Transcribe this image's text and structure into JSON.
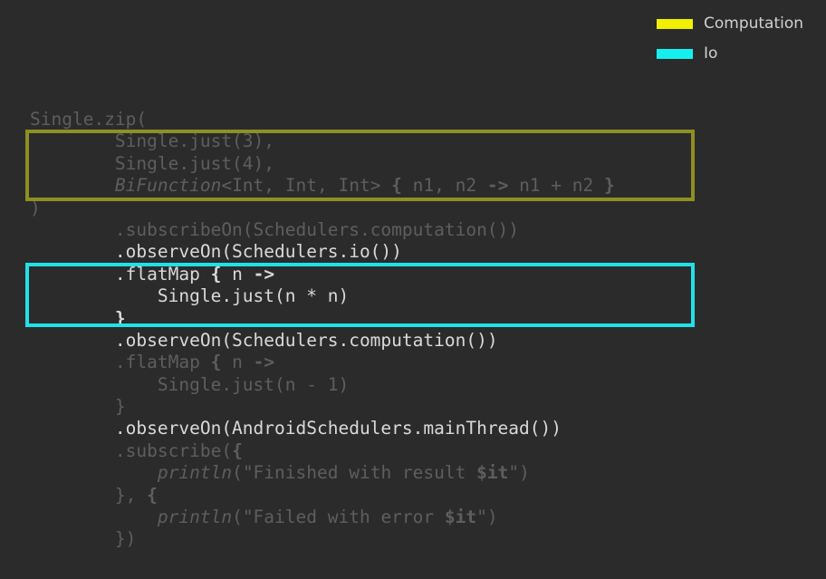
{
  "colors": {
    "background": "#2b2b2b",
    "computation": "#f0f000",
    "computation_box": "#8f8f22",
    "io": "#14f0f0",
    "io_box": "#22e0e8",
    "code_dim": "#5e5e5e",
    "code_bright": "#d9d9d9"
  },
  "legend": [
    {
      "label": "Computation",
      "color": "#f0f000"
    },
    {
      "label": "Io",
      "color": "#14f0f0"
    }
  ],
  "code": {
    "lines": [
      [
        {
          "text": "Single.zip(",
          "style": "dim"
        }
      ],
      [
        {
          "text": "        Single.just(3),",
          "style": "dim"
        }
      ],
      [
        {
          "text": "        Single.just(4),",
          "style": "dim"
        }
      ],
      [
        {
          "text": "        ",
          "style": "dim"
        },
        {
          "text": "BiFunction",
          "style": "dim italic"
        },
        {
          "text": "<Int, Int, Int> ",
          "style": "dim"
        },
        {
          "text": "{",
          "style": "dim bold"
        },
        {
          "text": " n1, n2 ",
          "style": "dim"
        },
        {
          "text": "->",
          "style": "dim bold"
        },
        {
          "text": " n1 + n2 ",
          "style": "dim"
        },
        {
          "text": "}",
          "style": "dim bold"
        }
      ],
      [
        {
          "text": ")",
          "style": "dim"
        }
      ],
      [
        {
          "text": "        .subscribeOn(Schedulers.computation())",
          "style": "dim"
        }
      ],
      [
        {
          "text": "        .observeOn(Schedulers.io())",
          "style": "bright"
        }
      ],
      [
        {
          "text": "        .flatMap ",
          "style": "bright"
        },
        {
          "text": "{",
          "style": "bright bold"
        },
        {
          "text": " n ",
          "style": "bright"
        },
        {
          "text": "->",
          "style": "bright bold"
        }
      ],
      [
        {
          "text": "            Single.just(n * n)",
          "style": "bright"
        }
      ],
      [
        {
          "text": "        ",
          "style": "bright"
        },
        {
          "text": "}",
          "style": "bright bold"
        }
      ],
      [
        {
          "text": "        .observeOn(Schedulers.computation())",
          "style": "bright"
        }
      ],
      [
        {
          "text": "        .flatMap ",
          "style": "dim"
        },
        {
          "text": "{",
          "style": "dim bold"
        },
        {
          "text": " n ",
          "style": "dim"
        },
        {
          "text": "->",
          "style": "dim bold"
        }
      ],
      [
        {
          "text": "            Single.just(n - 1)",
          "style": "dim"
        }
      ],
      [
        {
          "text": "        }",
          "style": "dim"
        }
      ],
      [
        {
          "text": "        .observeOn(AndroidSchedulers.mainThread())",
          "style": "bright"
        }
      ],
      [
        {
          "text": "        .subscribe(",
          "style": "dim"
        },
        {
          "text": "{",
          "style": "dim bold"
        }
      ],
      [
        {
          "text": "            ",
          "style": "dim"
        },
        {
          "text": "println",
          "style": "dim italic"
        },
        {
          "text": "(\"Finished with result ",
          "style": "dim"
        },
        {
          "text": "$it",
          "style": "dim bold"
        },
        {
          "text": "\")",
          "style": "dim"
        }
      ],
      [
        {
          "text": "        }, ",
          "style": "dim"
        },
        {
          "text": "{",
          "style": "dim bold"
        }
      ],
      [
        {
          "text": "            ",
          "style": "dim"
        },
        {
          "text": "println",
          "style": "dim italic"
        },
        {
          "text": "(\"Failed with error ",
          "style": "dim"
        },
        {
          "text": "$it",
          "style": "dim bold"
        },
        {
          "text": "\")",
          "style": "dim"
        }
      ],
      [
        {
          "text": "        })",
          "style": "dim"
        }
      ]
    ]
  }
}
